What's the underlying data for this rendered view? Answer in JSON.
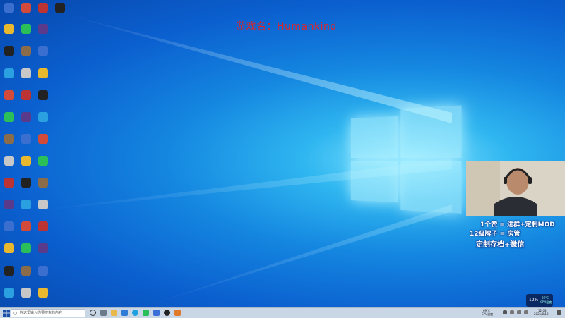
{
  "game_title": "游戏名：Humankind",
  "overlay": {
    "line1": "1个赞 = 进群+定制MOD",
    "line2": "12级牌子 = 房管",
    "line3": "定制存档+微信"
  },
  "taskbar": {
    "search_placeholder": "在这里输入你要搜索的内容",
    "tray_temp": "69°C",
    "tray_cpu": "CPU温度",
    "clock_time": "12:08",
    "clock_date": "2021/8/18"
  },
  "tray_widget": {
    "percent": "12%",
    "temp": "69°C",
    "label": "CPU温度"
  },
  "colors": {
    "title_red": "#e0242a",
    "desktop_blue": "#0b5fcf",
    "taskbar": "#c9d6e6"
  }
}
